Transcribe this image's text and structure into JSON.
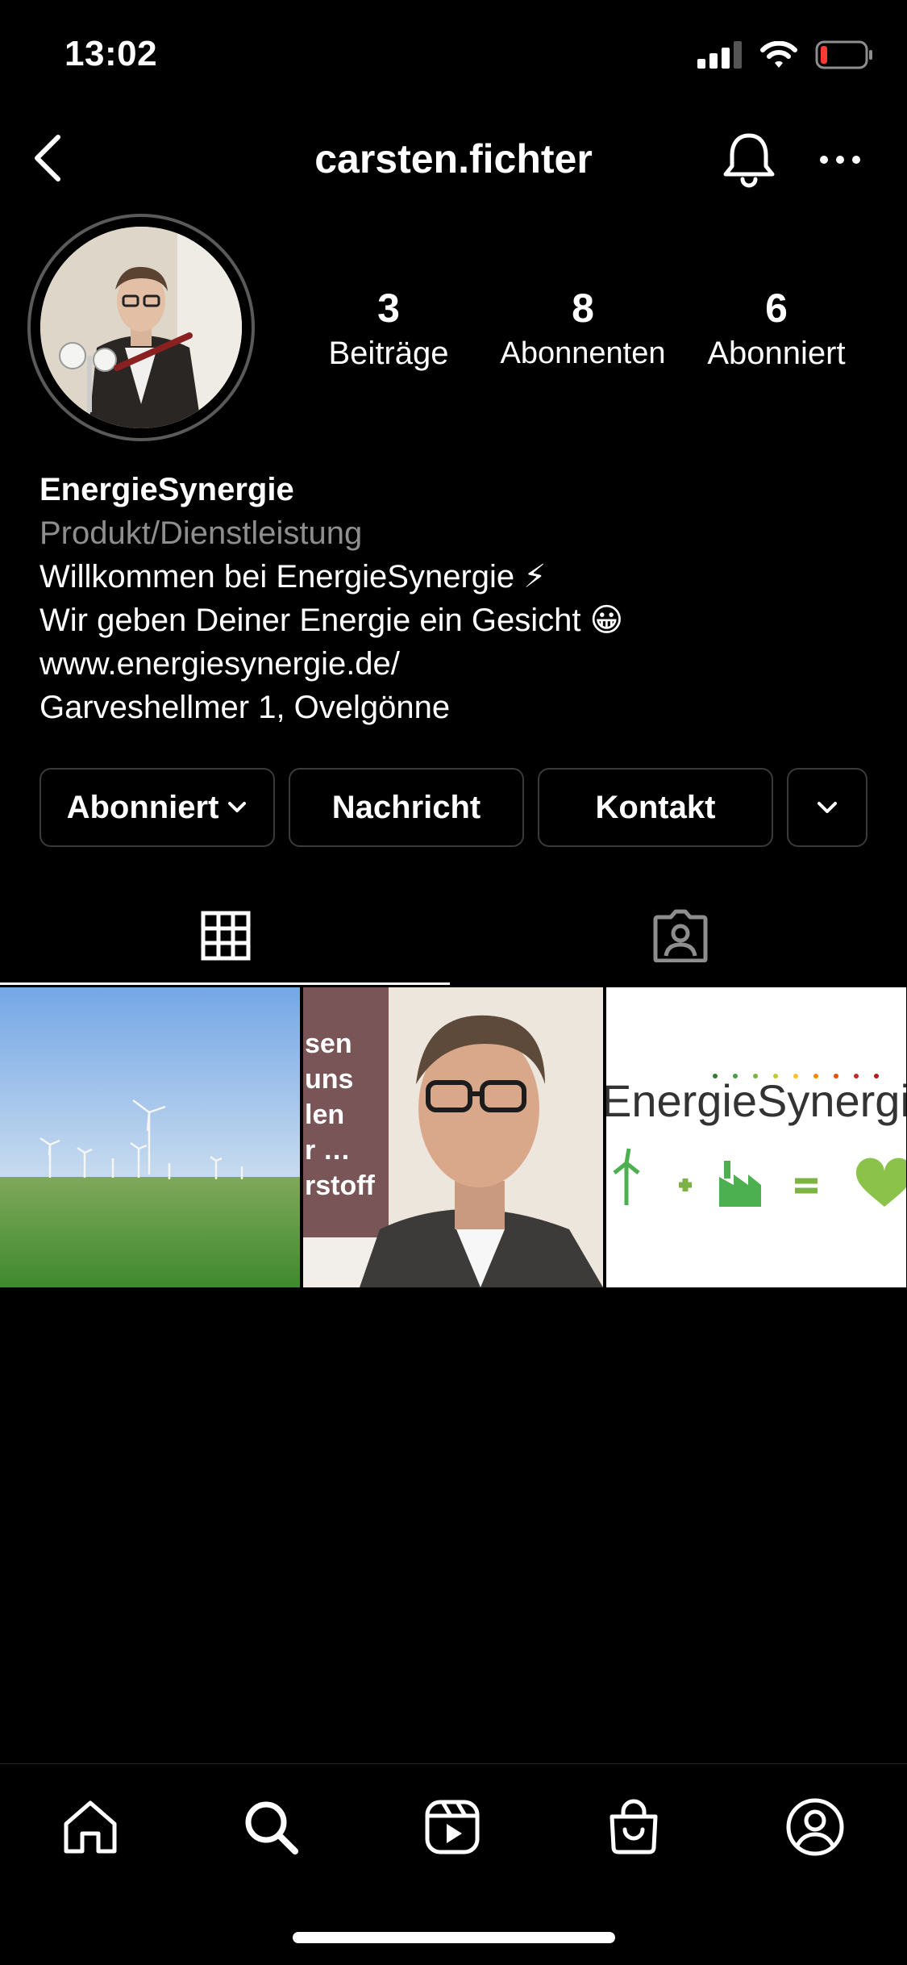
{
  "status_bar": {
    "time": "13:02"
  },
  "header": {
    "username": "carsten.fichter"
  },
  "stats": [
    {
      "count": "3",
      "label": "Beiträge"
    },
    {
      "count": "8",
      "label": "Abonnenten"
    },
    {
      "count": "6",
      "label": "Abonniert"
    }
  ],
  "bio": {
    "name": "EnergieSynergie",
    "category": "Produkt/Dienstleistung",
    "line1": "Willkommen bei EnergieSynergie ⚡",
    "line2": "Wir geben Deiner Energie ein Gesicht 😀",
    "website": "www.energiesynergie.de/",
    "address": "Garveshellmer 1, Ovelgönne"
  },
  "actions": {
    "following_label": "Abonniert",
    "message_label": "Nachricht",
    "contact_label": "Kontakt"
  },
  "posts": {
    "post2_text": [
      "sen",
      "uns",
      "len",
      "r …",
      "rstoff"
    ],
    "post3_logo": "EnergieSynergie"
  },
  "icons": {
    "back": "chevron-left-icon",
    "bell": "bell-icon",
    "more": "more-icon",
    "grid_tab": "grid-icon",
    "tagged_tab": "tagged-person-icon",
    "nav": [
      "home-icon",
      "search-icon",
      "reels-icon",
      "shop-icon",
      "profile-icon"
    ]
  },
  "colors": {
    "background": "#000000",
    "secondary_text": "#8e8e8e",
    "battery_low": "#ff3b30",
    "brand_green": "#6abf2e"
  }
}
